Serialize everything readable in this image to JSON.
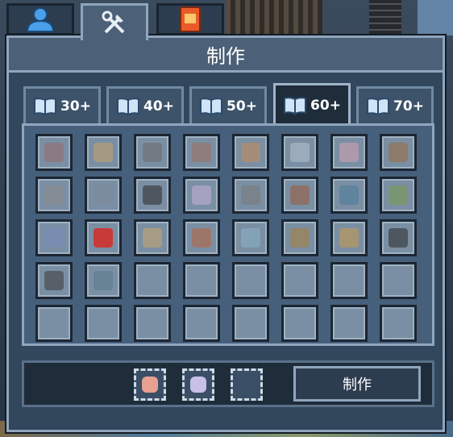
{
  "top_tabs": [
    {
      "icon": "player-icon",
      "active": false
    },
    {
      "icon": "tools-icon",
      "active": true
    },
    {
      "icon": "book-icon",
      "active": false
    }
  ],
  "panel": {
    "title": "制作"
  },
  "level_tabs": [
    {
      "label": "30+",
      "icon": "book-icon",
      "active": false
    },
    {
      "label": "40+",
      "icon": "book-icon",
      "active": false
    },
    {
      "label": "50+",
      "icon": "book-icon",
      "active": false
    },
    {
      "label": "60+",
      "icon": "book-icon",
      "active": true
    },
    {
      "label": "70+",
      "icon": "book-icon",
      "active": false
    }
  ],
  "recipe_grid": {
    "rows": 5,
    "cols": 8,
    "items": [
      {
        "icon": "wand-icon",
        "color": "#9a6a6a"
      },
      {
        "icon": "scroll-icon",
        "color": "#c9a26b"
      },
      {
        "icon": "ore-icon",
        "color": "#6b6b6b"
      },
      {
        "icon": "meat-icon",
        "color": "#a07060"
      },
      {
        "icon": "key-icon",
        "color": "#c88a5a"
      },
      {
        "icon": "paper-icon",
        "color": "#b8c2cc"
      },
      {
        "icon": "cloth-icon",
        "color": "#d6a3b4"
      },
      {
        "icon": "log-icon",
        "color": "#9a6a3c"
      },
      {
        "icon": "hammer-icon",
        "color": "#8a8a8a"
      },
      {
        "icon": "spear-icon",
        "color": "#7a8a9a"
      },
      {
        "icon": "coal-icon",
        "color": "#2a2a2a"
      },
      {
        "icon": "shirt-icon",
        "color": "#c8b0d8"
      },
      {
        "icon": "pickaxe-icon",
        "color": "#7a7a7a"
      },
      {
        "icon": "wood-icon",
        "color": "#9a5a3a"
      },
      {
        "icon": "shovel-icon",
        "color": "#4a7a9a"
      },
      {
        "icon": "shovel-gold-icon",
        "color": "#7a9a4a"
      },
      {
        "icon": "shovel-blue-icon",
        "color": "#7a8aba"
      },
      {
        "icon": "shovel-red-icon",
        "color": "#c83a3a"
      },
      {
        "icon": "shovel-tan-icon",
        "color": "#c8a86a"
      },
      {
        "icon": "bread-icon",
        "color": "#b8643a"
      },
      {
        "icon": "wrench-icon",
        "color": "#8ab0c8"
      },
      {
        "icon": "pickaxe-gold-icon",
        "color": "#a8803a"
      },
      {
        "icon": "shovel-yellow-icon",
        "color": "#c89a4a"
      },
      {
        "icon": "ore-dark-icon",
        "color": "#2a2a2a"
      },
      {
        "icon": "boot-icon",
        "color": "#3a3a3a"
      },
      {
        "icon": "rope-icon",
        "color": "#5a7a8a"
      }
    ]
  },
  "craft": {
    "materials": [
      {
        "icon": "meat-icon",
        "color": "#e8a090"
      },
      {
        "icon": "crystal-icon",
        "color": "#c8c0e8"
      },
      {
        "icon": "empty-slot-icon",
        "color": ""
      }
    ],
    "button_label": "制作"
  }
}
